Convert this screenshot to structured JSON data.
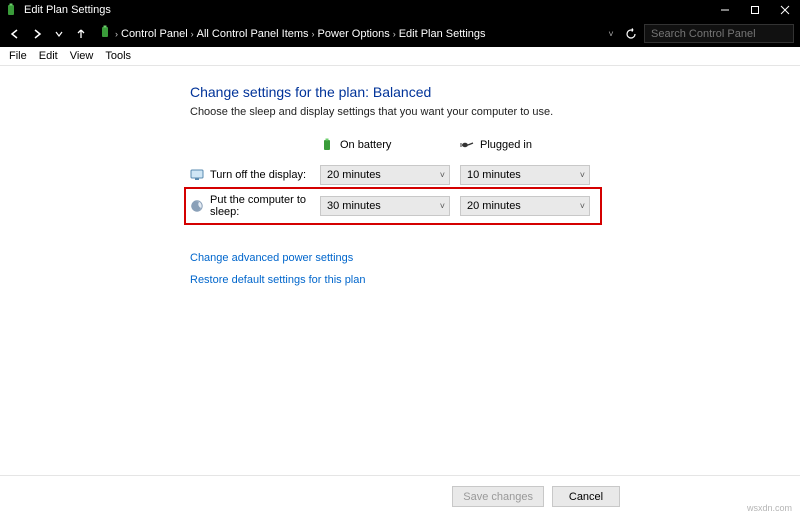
{
  "titlebar": {
    "title": "Edit Plan Settings"
  },
  "breadcrumb": {
    "items": [
      "Control Panel",
      "All Control Panel Items",
      "Power Options",
      "Edit Plan Settings"
    ]
  },
  "search": {
    "placeholder": "Search Control Panel"
  },
  "menubar": {
    "items": [
      "File",
      "Edit",
      "View",
      "Tools"
    ]
  },
  "page": {
    "heading": "Change settings for the plan: Balanced",
    "sub": "Choose the sleep and display settings that you want your computer to use.",
    "col_battery": "On battery",
    "col_plugged": "Plugged in",
    "rows": [
      {
        "label": "Turn off the display:",
        "battery": "20 minutes",
        "plugged": "10 minutes"
      },
      {
        "label": "Put the computer to sleep:",
        "battery": "30 minutes",
        "plugged": "20 minutes"
      }
    ],
    "link_advanced": "Change advanced power settings",
    "link_restore": "Restore default settings for this plan"
  },
  "footer": {
    "save": "Save changes",
    "cancel": "Cancel"
  },
  "watermark": "wsxdn.com"
}
